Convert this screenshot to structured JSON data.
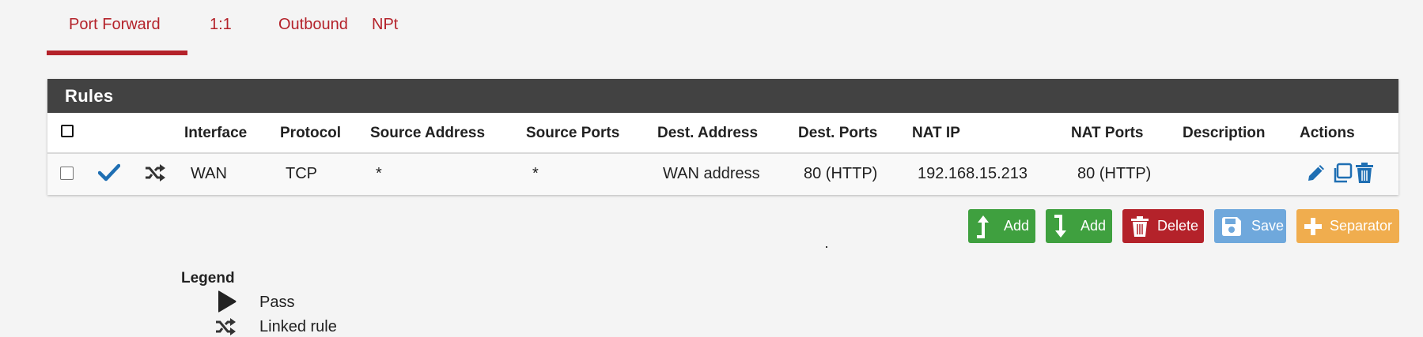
{
  "tabs": [
    {
      "label": "Port Forward",
      "active": true
    },
    {
      "label": "1:1"
    },
    {
      "label": "Outbound"
    },
    {
      "label": "NPt"
    }
  ],
  "panel": {
    "title": "Rules"
  },
  "table": {
    "headers": [
      "Interface",
      "Protocol",
      "Source Address",
      "Source Ports",
      "Dest. Address",
      "Dest. Ports",
      "NAT IP",
      "NAT Ports",
      "Description",
      "Actions"
    ],
    "rows": [
      {
        "interface": "WAN",
        "protocol": "TCP",
        "source_address": "*",
        "source_ports": "*",
        "dest_address": "WAN address",
        "dest_ports": "80 (HTTP)",
        "nat_ip": "192.168.15.213",
        "nat_ports": "80 (HTTP)",
        "description": ""
      }
    ]
  },
  "buttons": {
    "add_top": "Add",
    "add_bottom": "Add",
    "delete": "Delete",
    "save": "Save",
    "separator": "Separator"
  },
  "legend": {
    "title": "Legend",
    "items": [
      {
        "icon": "play-icon",
        "label": "Pass"
      },
      {
        "icon": "random-icon",
        "label": "Linked rule"
      }
    ]
  },
  "colors": {
    "brand": "#b4222a",
    "header": "#424242",
    "success": "#3fa03f",
    "info": "#6fa8dc",
    "warning": "#f0ad4e",
    "link": "#1f6fb3"
  }
}
